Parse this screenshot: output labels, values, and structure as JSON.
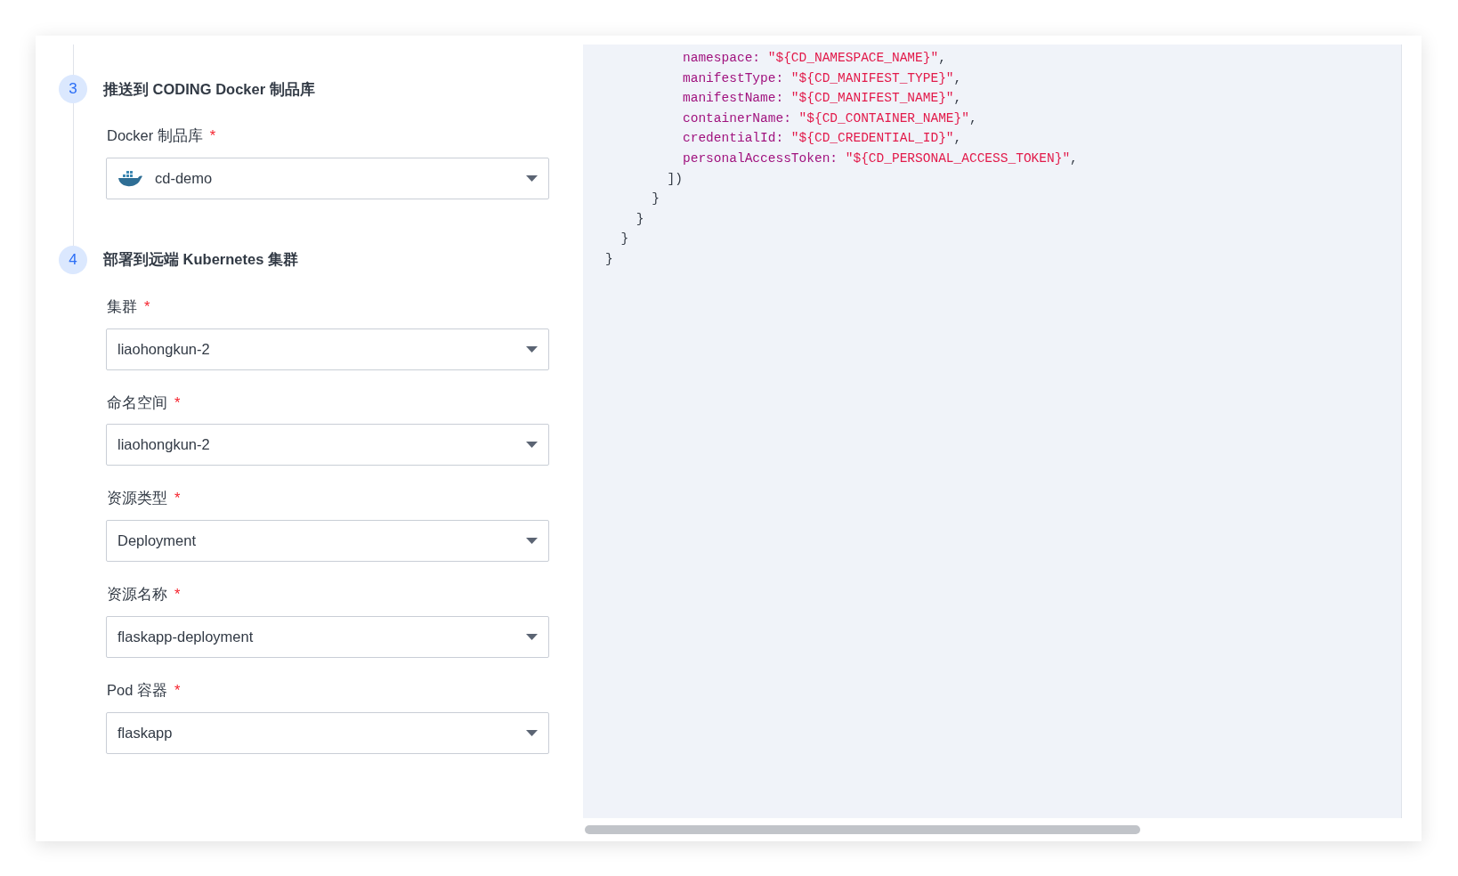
{
  "steps": [
    {
      "number": "3",
      "title": "推送到 CODING Docker 制品库",
      "fields": [
        {
          "label": "Docker 制品库",
          "mark": "*",
          "value": "cd-demo",
          "kind": "image"
        }
      ]
    },
    {
      "number": "4",
      "title": "部署到远端 Kubernetes 集群",
      "fields": [
        {
          "label": "集群",
          "mark": "*",
          "value": "liaohongkun-2",
          "kind": "text"
        },
        {
          "label": "命名空间",
          "mark": "*",
          "value": "liaohongkun-2",
          "kind": "text"
        },
        {
          "label": "资源类型",
          "mark": "*",
          "value": "Deployment",
          "kind": "text"
        },
        {
          "label": "资源名称",
          "mark": "*",
          "value": "flaskapp-deployment",
          "kind": "text"
        },
        {
          "label": "Pod 容器",
          "mark": "*",
          "value": "flaskapp",
          "kind": "text"
        }
      ]
    }
  ],
  "code": [
    {
      "kind": "prop",
      "key": "          namespace:",
      "value": "\"${CD_NAMESPACE_NAME}\"",
      "punct": ","
    },
    {
      "kind": "prop",
      "key": "          manifestType:",
      "value": "\"${CD_MANIFEST_TYPE}\"",
      "punct": ","
    },
    {
      "kind": "prop",
      "key": "          manifestName:",
      "value": "\"${CD_MANIFEST_NAME}\"",
      "punct": ","
    },
    {
      "kind": "prop",
      "key": "          containerName:",
      "value": "\"${CD_CONTAINER_NAME}\"",
      "punct": ","
    },
    {
      "kind": "prop",
      "key": "          credentialId:",
      "value": "\"${CD_CREDENTIAL_ID}\"",
      "punct": ","
    },
    {
      "kind": "prop",
      "key": "          personalAccessToken:",
      "value": "\"${CD_PERSONAL_ACCESS_TOKEN}\"",
      "punct": ","
    },
    {
      "kind": "plain",
      "text": "        ])"
    },
    {
      "kind": "plain",
      "text": "      }"
    },
    {
      "kind": "plain",
      "text": "    }"
    },
    {
      "kind": "plain",
      "text": "  }"
    },
    {
      "kind": "plain",
      "text": "}"
    }
  ]
}
